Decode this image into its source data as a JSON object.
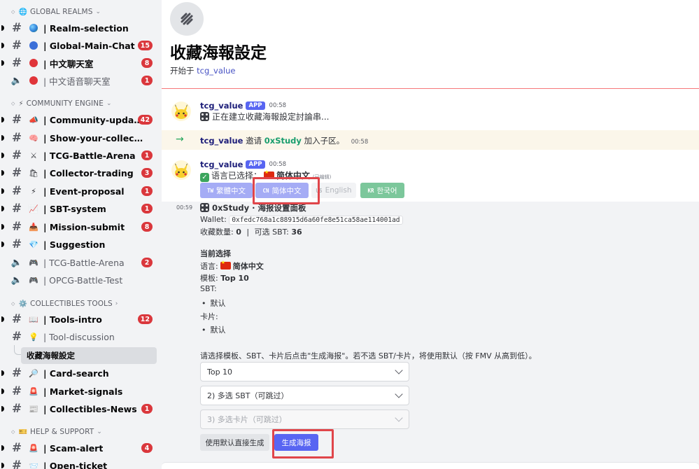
{
  "sidebar": {
    "categories": [
      {
        "emoji": "🌐",
        "label": "GLOBAL REALMS",
        "chevron": "⌄"
      },
      {
        "emoji": "⚡",
        "label": "COMMUNITY ENGINE",
        "chevron": "⌄"
      },
      {
        "emoji": "⚙️",
        "label": "COLLECTIBLES TOOLS",
        "chevron": "›"
      },
      {
        "emoji": "🎫",
        "label": "HELP & SUPPORT",
        "chevron": "⌄"
      }
    ],
    "channels": [
      {
        "label": "| Realm-selection",
        "badge": ""
      },
      {
        "label": "| Global-Main-Chat",
        "badge": "15"
      },
      {
        "label": "| 中文聊天室",
        "badge": "8"
      },
      {
        "label": "| 中文语音聊天室",
        "badge": "1"
      },
      {
        "label": "| Community-updates",
        "badge": "42"
      },
      {
        "label": "| Show-your-collectibles",
        "badge": ""
      },
      {
        "label": "| TCG-Battle-Arena",
        "badge": "1"
      },
      {
        "label": "| Collector-trading",
        "badge": "3"
      },
      {
        "label": "| Event-proposal",
        "badge": "1"
      },
      {
        "label": "| SBT-system",
        "badge": "1"
      },
      {
        "label": "| Mission-submit",
        "badge": "8"
      },
      {
        "label": "| Suggestion",
        "badge": ""
      },
      {
        "label": "| TCG-Battle-Arena",
        "badge": "2"
      },
      {
        "label": "| OPCG-Battle-Test",
        "badge": ""
      },
      {
        "label": "| Tools-intro",
        "badge": "12"
      },
      {
        "label": "| Tool-discussion",
        "badge": ""
      },
      {
        "label": "收藏海報設定",
        "badge": ""
      },
      {
        "label": "| Card-search",
        "badge": ""
      },
      {
        "label": "| Market-signals",
        "badge": ""
      },
      {
        "label": "| Collectibles-News",
        "badge": "1"
      },
      {
        "label": "| Scam-alert",
        "badge": "4"
      },
      {
        "label": "| Open-ticket",
        "badge": ""
      }
    ]
  },
  "thread": {
    "title": "收藏海報設定",
    "started_prefix": "开始于",
    "started_by": "tcg_value"
  },
  "messages": {
    "m1": {
      "user": "tcg_value",
      "tag": "APP",
      "time": "00:58",
      "text": "正在建立收藏海報設定討論串..."
    },
    "sys": {
      "user": "tcg_value",
      "verb": "邀请",
      "target": "0xStudy",
      "suffix": "加入子区。",
      "time": "00:58"
    },
    "m2": {
      "user": "tcg_value",
      "tag": "APP",
      "time": "00:58",
      "text_prefix": "语言已选择：",
      "lang": "简体中文",
      "edited": "(已编辑)"
    }
  },
  "lang_buttons": [
    {
      "code": "TW",
      "label": "繁體中文"
    },
    {
      "code": "CN",
      "label": "简体中文"
    },
    {
      "code": "US",
      "label": "English"
    },
    {
      "code": "KR",
      "label": "한국어"
    }
  ],
  "panel": {
    "time": "00:59",
    "title": "0xStudy · 海报设置面板",
    "wallet_label": "Wallet:",
    "wallet": "0xfedc768a1c88915d6a60fe8e51ca58ae114001ad",
    "count_label": "收藏数量:",
    "count": "0",
    "sep": "|",
    "sbt_label": "可选 SBT:",
    "sbt_count": "36",
    "current_heading": "当前选择",
    "lang_label": "语言:",
    "lang_value": "简体中文",
    "template_label": "模板:",
    "template_value": "Top 10",
    "sbt_section": "SBT:",
    "sbt_item": "默认",
    "card_section": "卡片:",
    "card_item": "默认",
    "instruction": "请选择模板、SBT、卡片后点击\"生成海报\"。若不选 SBT/卡片，将使用默认（按 FMV 从高到低）。",
    "select_template": "Top 10",
    "select_sbt": "2) 多选 SBT（可跳过）",
    "select_cards": "3) 多选卡片（可跳过）",
    "btn_default": "使用默认直接生成",
    "btn_generate": "生成海报"
  },
  "colors": {
    "accent": "#5865f2",
    "highlight": "#e0454a",
    "badge": "#da373c"
  }
}
